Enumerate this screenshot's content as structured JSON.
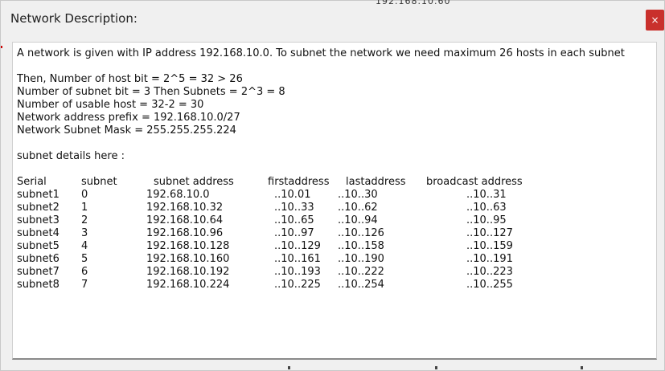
{
  "background_peek": "192.168.10.60",
  "dialog": {
    "title": "Network Description:",
    "close_label": "×"
  },
  "content": {
    "intro": "A network is given with IP address 192.168.10.0. To subnet the network we need maximum 26 hosts in each subnet",
    "calc_lines": [
      "Then, Number of host bit = 2^5 = 32 > 26",
      "Number of subnet bit = 3 Then Subnets = 2^3 = 8",
      "Number of usable host = 32-2 = 30",
      "Network address prefix = 192.168.10.0/27",
      "Network Subnet Mask = 255.255.255.224"
    ],
    "details_heading": "subnet details here :",
    "table": {
      "headers": [
        "Serial",
        "subnet",
        "subnet address",
        "firstaddress",
        "lastaddress",
        "broadcast address"
      ],
      "rows": [
        [
          "subnet1",
          "0",
          "192.68.10.0",
          "..10.01",
          "..10..30",
          "..10..31"
        ],
        [
          "subnet2",
          "1",
          "192.168.10.32",
          "..10..33",
          "..10..62",
          "..10..63"
        ],
        [
          "subnet3",
          "2",
          "192.168.10.64",
          "..10..65",
          "..10..94",
          "..10..95"
        ],
        [
          "subnet4",
          "3",
          "192.168.10.96",
          "..10..97",
          "..10..126",
          "..10..127"
        ],
        [
          "subnet5",
          "4",
          "192.168.10.128",
          "..10..129",
          "..10..158",
          "..10..159"
        ],
        [
          "subnet6",
          "5",
          "192.168.10.160",
          "..10..161",
          "..10..190",
          "..10..191"
        ],
        [
          "subnet7",
          "6",
          "192.168.10.192",
          "..10..193",
          "..10..222",
          "..10..223"
        ],
        [
          "subnet8",
          "7",
          "192.168.10.224",
          "..10..225",
          "..10..254",
          "..10..255"
        ]
      ]
    }
  }
}
